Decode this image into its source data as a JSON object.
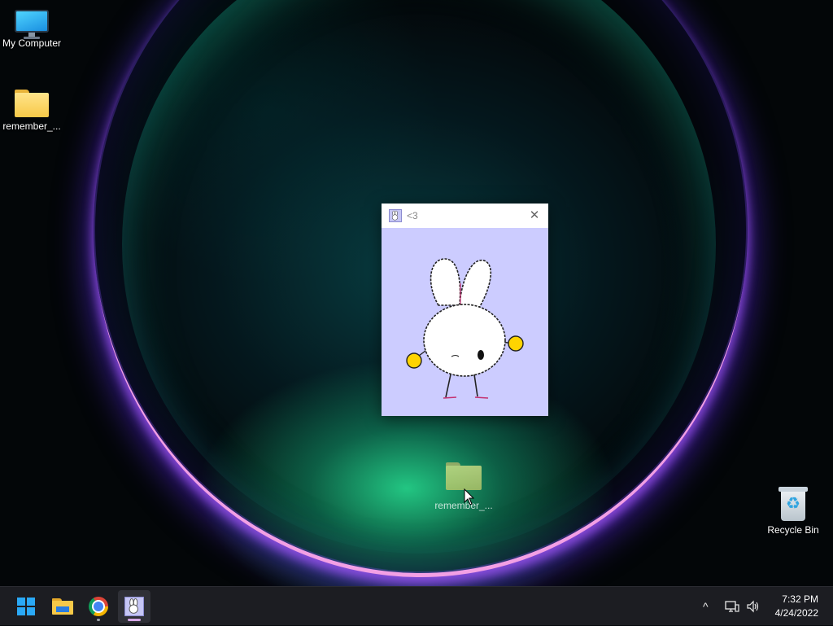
{
  "desktop": {
    "icons": [
      {
        "label": "My Computer",
        "icon": "monitor-icon"
      },
      {
        "label": "remember_...",
        "icon": "folder-icon"
      },
      {
        "label": "Recycle Bin",
        "icon": "recycle-bin-icon"
      }
    ],
    "dragging": {
      "label": "remember_...",
      "icon": "folder-icon"
    }
  },
  "window": {
    "title": "<3",
    "close_glyph": "✕",
    "background": "#ccccff",
    "character": "bunny-illustration"
  },
  "taskbar": {
    "apps": [
      {
        "name": "Start",
        "icon": "windows-start-icon"
      },
      {
        "name": "File Explorer",
        "icon": "file-explorer-icon"
      },
      {
        "name": "Google Chrome",
        "icon": "chrome-icon"
      },
      {
        "name": "<3",
        "icon": "bunny-app-icon",
        "active": true
      }
    ],
    "tray": {
      "chevron": "^",
      "network_icon": "network-icon",
      "volume_icon": "volume-icon"
    },
    "clock": {
      "time": "7:32 PM",
      "date": "4/24/2022"
    }
  }
}
